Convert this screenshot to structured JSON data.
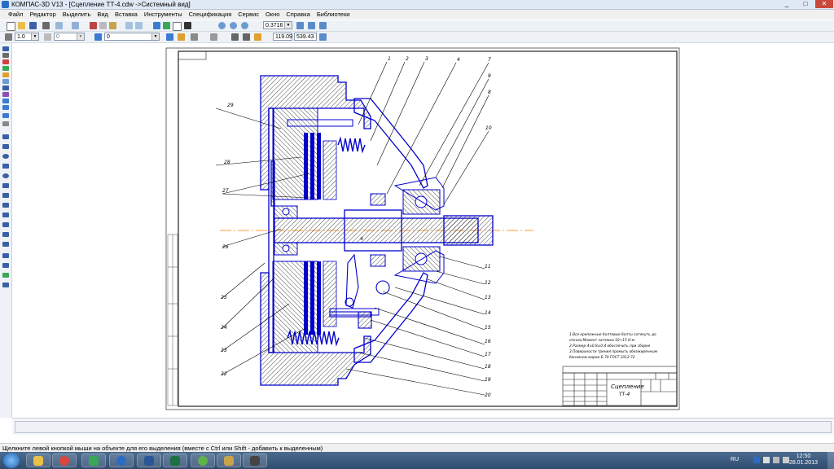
{
  "window": {
    "title": "КОМПАС-3D V13 - [Сцепление ТТ-4.cdw ->Системный вид]"
  },
  "menu": [
    "Файл",
    "Редактор",
    "Выделить",
    "Вид",
    "Вставка",
    "Инструменты",
    "Спецификация",
    "Сервис",
    "Окно",
    "Справка",
    "Библиотеки"
  ],
  "toolbar": {
    "zoom_value": "0.3716",
    "coord_x": "119.09",
    "coord_y": "539.43",
    "line_scale": "1.0",
    "layer": "0",
    "style": "0"
  },
  "drawing": {
    "stamp_name": "Сцепление",
    "stamp_code": "ТТ-4",
    "notes": [
      "1.Все крепежные болтовые болты затянуть до",
      "   отказа.Момент затяжки 10÷15 Н·м.",
      "2.Размер 4±0.8±0.4 обеспечить при сборке",
      "3.Поверхности трения промыть обезжиренным",
      "   бензином марки Б-70 ГОСТ 1012-72"
    ],
    "callouts_top": [
      "1",
      "2",
      "3",
      "4",
      "7",
      "9",
      "8",
      "10"
    ],
    "callouts_right": [
      "11",
      "12",
      "13",
      "14",
      "15",
      "16",
      "17",
      "18",
      "19",
      "20"
    ],
    "callouts_left": [
      "29",
      "28",
      "27",
      "26",
      "25",
      "24",
      "23",
      "22"
    ],
    "gap_label": "4"
  },
  "status": {
    "hint": "Щелкните левой кнопкой мыши на объекте для его выделения (вместе с Ctrl или Shift - добавить к выделенным)"
  },
  "taskbar": {
    "lang": "RU",
    "time": "12:50",
    "date": "28.01.2013"
  },
  "colors": {
    "drawing_line": "#0000cc",
    "axis_line": "#ff7f00",
    "hatch": "#000000",
    "titlebar": "#dfe9f5",
    "taskbar": "#2f4c6e"
  }
}
